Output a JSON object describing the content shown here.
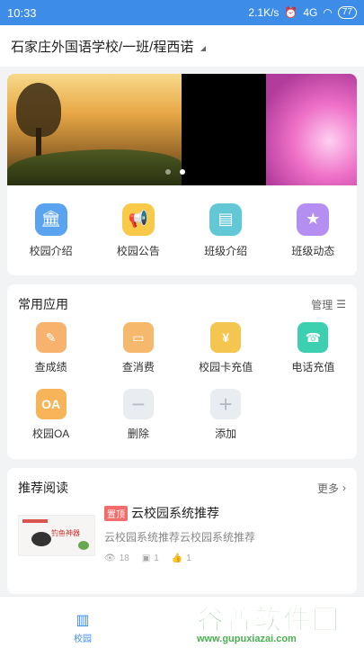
{
  "status_bar": {
    "time": "10:33",
    "network_speed": "2.1K/s",
    "signal": "4G",
    "battery": "77"
  },
  "header": {
    "title": "石家庄外国语学校/一班/程西诺"
  },
  "banner": {
    "active_index": 1,
    "slide_count": 2
  },
  "quick_links": [
    {
      "label": "校园介绍",
      "icon": "building-icon",
      "color": "#5aa3ee"
    },
    {
      "label": "校园公告",
      "icon": "megaphone-icon",
      "color": "#f9c94a"
    },
    {
      "label": "班级介绍",
      "icon": "class-icon",
      "color": "#62c8d6"
    },
    {
      "label": "班级动态",
      "icon": "star-icon",
      "color": "#b48ef0"
    }
  ],
  "apps": {
    "title": "常用应用",
    "manage_label": "管理",
    "items": [
      {
        "label": "查成绩",
        "icon": "grades-icon",
        "color": "#f7b26d"
      },
      {
        "label": "查消费",
        "icon": "wallet-icon",
        "color": "#f6b86b"
      },
      {
        "label": "校园卡充值",
        "icon": "card-icon",
        "color": "#f5c64f"
      },
      {
        "label": "电话充值",
        "icon": "phone-icon",
        "color": "#3ccfb0"
      },
      {
        "label": "校园OA",
        "icon": "oa-icon",
        "color": "#f7b458",
        "text": "OA"
      },
      {
        "label": "删除",
        "icon": "minus-icon",
        "symbol": "−"
      },
      {
        "label": "添加",
        "icon": "plus-icon",
        "symbol": "+"
      }
    ]
  },
  "reading": {
    "title": "推荐阅读",
    "more_label": "更多",
    "article": {
      "tag": "置顶",
      "title": "云校园系统推荐",
      "description": "云校园系统推荐云校园系统推荐",
      "views": "18",
      "comments": "1",
      "likes": "1",
      "thumb_text": "钓鱼神器"
    }
  },
  "tabbar": {
    "active_label": "校园"
  },
  "watermark": {
    "text": "谷普软件园",
    "url": "www.gupuxiazai.com"
  }
}
